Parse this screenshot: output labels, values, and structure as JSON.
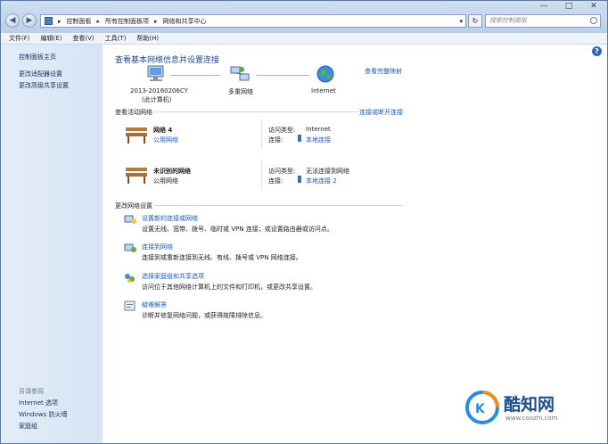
{
  "window": {
    "minimize_glyph": "—",
    "maximize_glyph": "□",
    "close_glyph": "✕"
  },
  "toolbar": {
    "back_glyph": "◀",
    "forward_glyph": "▶",
    "refresh_glyph": "↻",
    "dropdown_glyph": "▾",
    "breadcrumb": [
      "控制面板",
      "所有控制面板项",
      "网络和共享中心"
    ],
    "breadcrumb_sep": "▸",
    "search_placeholder": "搜索控制面板"
  },
  "menu": [
    "文件(F)",
    "编辑(E)",
    "查看(V)",
    "工具(T)",
    "帮助(H)"
  ],
  "sidebar": {
    "items": [
      "控制面板主页",
      "更改适配器设置",
      "更改高级共享设置"
    ],
    "see_also_heading": "另请参阅",
    "see_also": [
      "Internet 选项",
      "Windows 防火墙",
      "家庭组"
    ]
  },
  "main": {
    "title": "查看基本网络信息并设置连接",
    "view_full_map": "查看完整映射",
    "map": {
      "computer_name": "2013-20160206CY",
      "computer_sub": "(此计算机)",
      "multi_network": "多重网络",
      "internet": "Internet"
    },
    "active_heading": "查看活动网络",
    "connect_or_disconnect": "连接或断开连接",
    "networks": [
      {
        "name": "网络  4",
        "type": "公用网络",
        "type_is_link": true,
        "access_label": "访问类型:",
        "access_value": "Internet",
        "conn_label": "连接:",
        "conn_value": "本地连接"
      },
      {
        "name": "未识别的网络",
        "type": "公用网络",
        "type_is_link": false,
        "access_label": "访问类型:",
        "access_value": "无法连接到网络",
        "conn_label": "连接:",
        "conn_value": "本地连接 2"
      }
    ],
    "change_heading": "更改网络设置",
    "tasks": [
      {
        "link": "设置新的连接或网络",
        "desc": "设置无线、宽带、拨号、临时或 VPN 连接；或设置路由器或访问点。"
      },
      {
        "link": "连接到网络",
        "desc": "连接到或重新连接到无线、有线、拨号或 VPN 网络连接。"
      },
      {
        "link": "选择家庭组和共享选项",
        "desc": "访问位于其他网络计算机上的文件和打印机，或更改共享设置。"
      },
      {
        "link": "疑难解答",
        "desc": "诊断并修复网络问题，或获得故障排除信息。"
      }
    ],
    "help_glyph": "?"
  },
  "watermark": {
    "brand": "酷知网",
    "url": "www.coozhi.com"
  },
  "colors": {
    "link": "#1a5bb5",
    "title": "#1f4a8a",
    "sidebar_bg": "#dbe7f5",
    "watermark_blue": "#2a8be0",
    "watermark_orange": "#f28a1e"
  }
}
